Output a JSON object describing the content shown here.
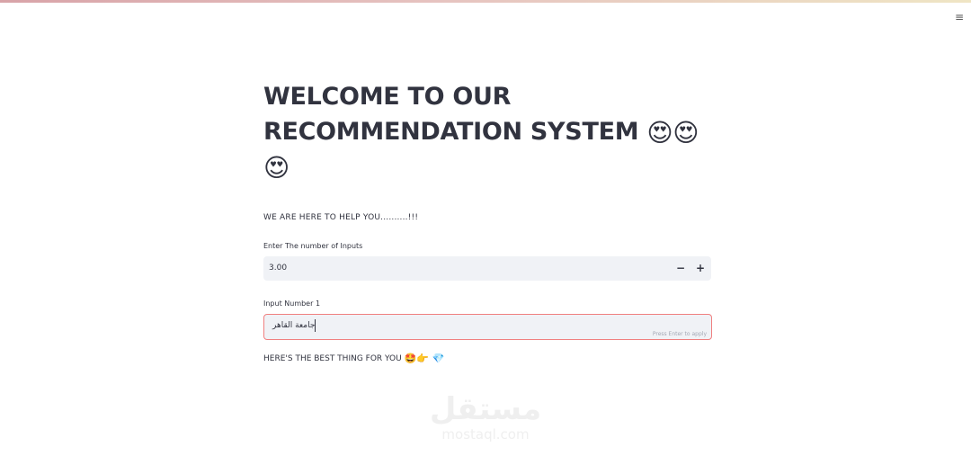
{
  "header": {
    "menu_icon": "≡"
  },
  "main": {
    "title": "WELCOME TO OUR RECOMMENDATION SYSTEM",
    "title_emojis": [
      "😍",
      "😍",
      "😍"
    ],
    "subtitle": "WE ARE HERE TO HELP YOU..........!!!",
    "number_field": {
      "label": "Enter The number of Inputs",
      "value": "3.00",
      "minus_label": "−",
      "plus_label": "+"
    },
    "text_field": {
      "label": "Input Number 1",
      "value": "جامعة القاهر",
      "hint": "Press Enter to apply"
    },
    "result": {
      "text": "HERE'S THE BEST THING FOR YOU",
      "emojis": "🤩👉 💎"
    }
  },
  "watermark": {
    "arabic": "مستقل",
    "latin": "mostaql.com"
  },
  "colors": {
    "text": "#31333f",
    "input_bg": "#f0f2f6",
    "focus_border": "#f08080"
  }
}
